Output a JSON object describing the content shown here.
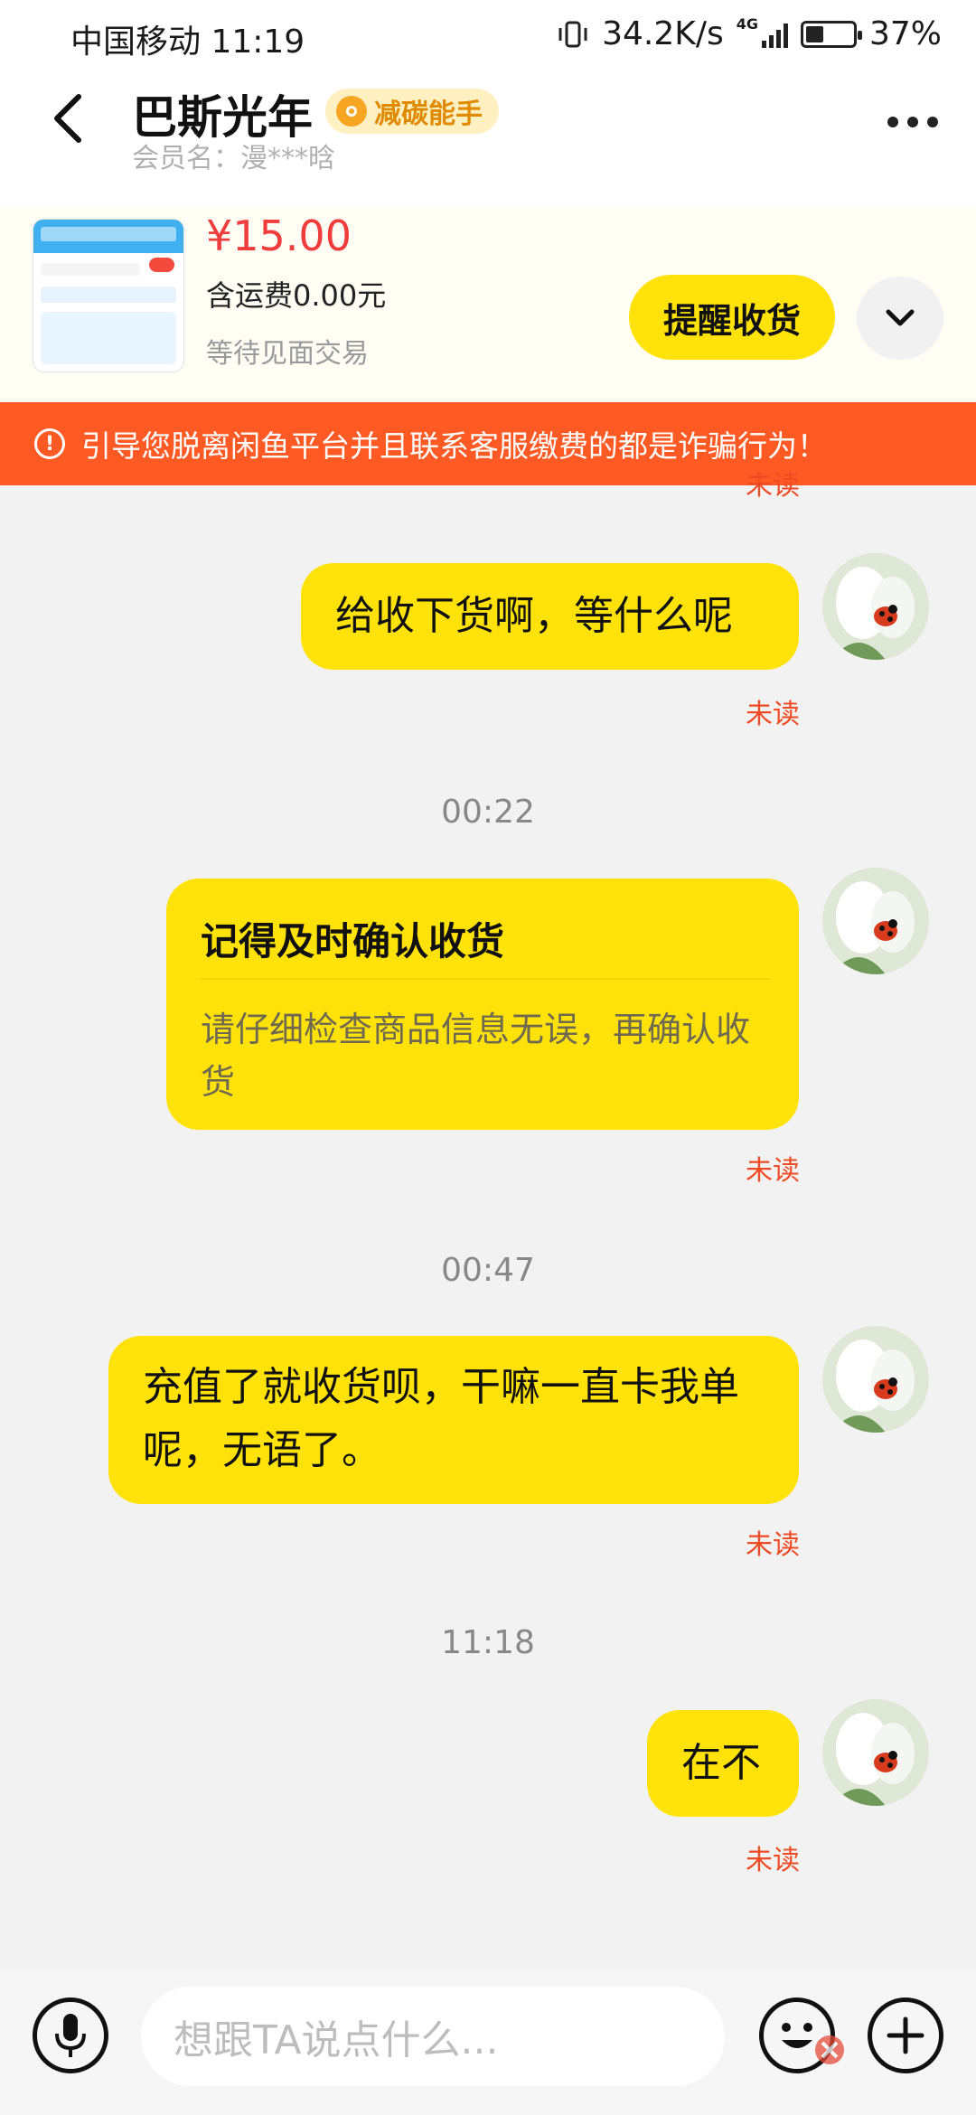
{
  "status_bar": {
    "carrier_time": "中国移动 11:19",
    "speed": "34.2K/s",
    "network": "4G",
    "battery": "37%",
    "battery_level": 0.37
  },
  "header": {
    "title": "巴斯光年",
    "badge": "减碳能手",
    "member": "会员名：漫***晗"
  },
  "product": {
    "price": "¥15.00",
    "shipping": "含运费0.00元",
    "state": "等待见面交易",
    "remind_button": "提醒收货"
  },
  "warning": {
    "text": "引导您脱离闲鱼平台并且联系客服缴费的都是诈骗行为！"
  },
  "chat": {
    "partial_top": "未读",
    "messages": [
      {
        "text": "给收下货啊，等什么呢",
        "status": "未读"
      },
      {
        "time": "00:22"
      },
      {
        "card_title": "记得及时确认收货",
        "card_body": "请仔细检查商品信息无误，再确认收货",
        "status": "未读"
      },
      {
        "time": "00:47"
      },
      {
        "text": "充值了就收货呗，干嘛一直卡我单呢，无语了。",
        "status": "未读"
      },
      {
        "time": "11:18"
      },
      {
        "text": "在不",
        "status": "未读"
      }
    ]
  },
  "composer": {
    "placeholder": "想跟TA说点什么..."
  },
  "colors": {
    "accent_yellow": "#ffe20a",
    "warning_bg": "#ff5a23",
    "price_red": "#ef3d3d",
    "unread_red": "#ef4a23"
  }
}
